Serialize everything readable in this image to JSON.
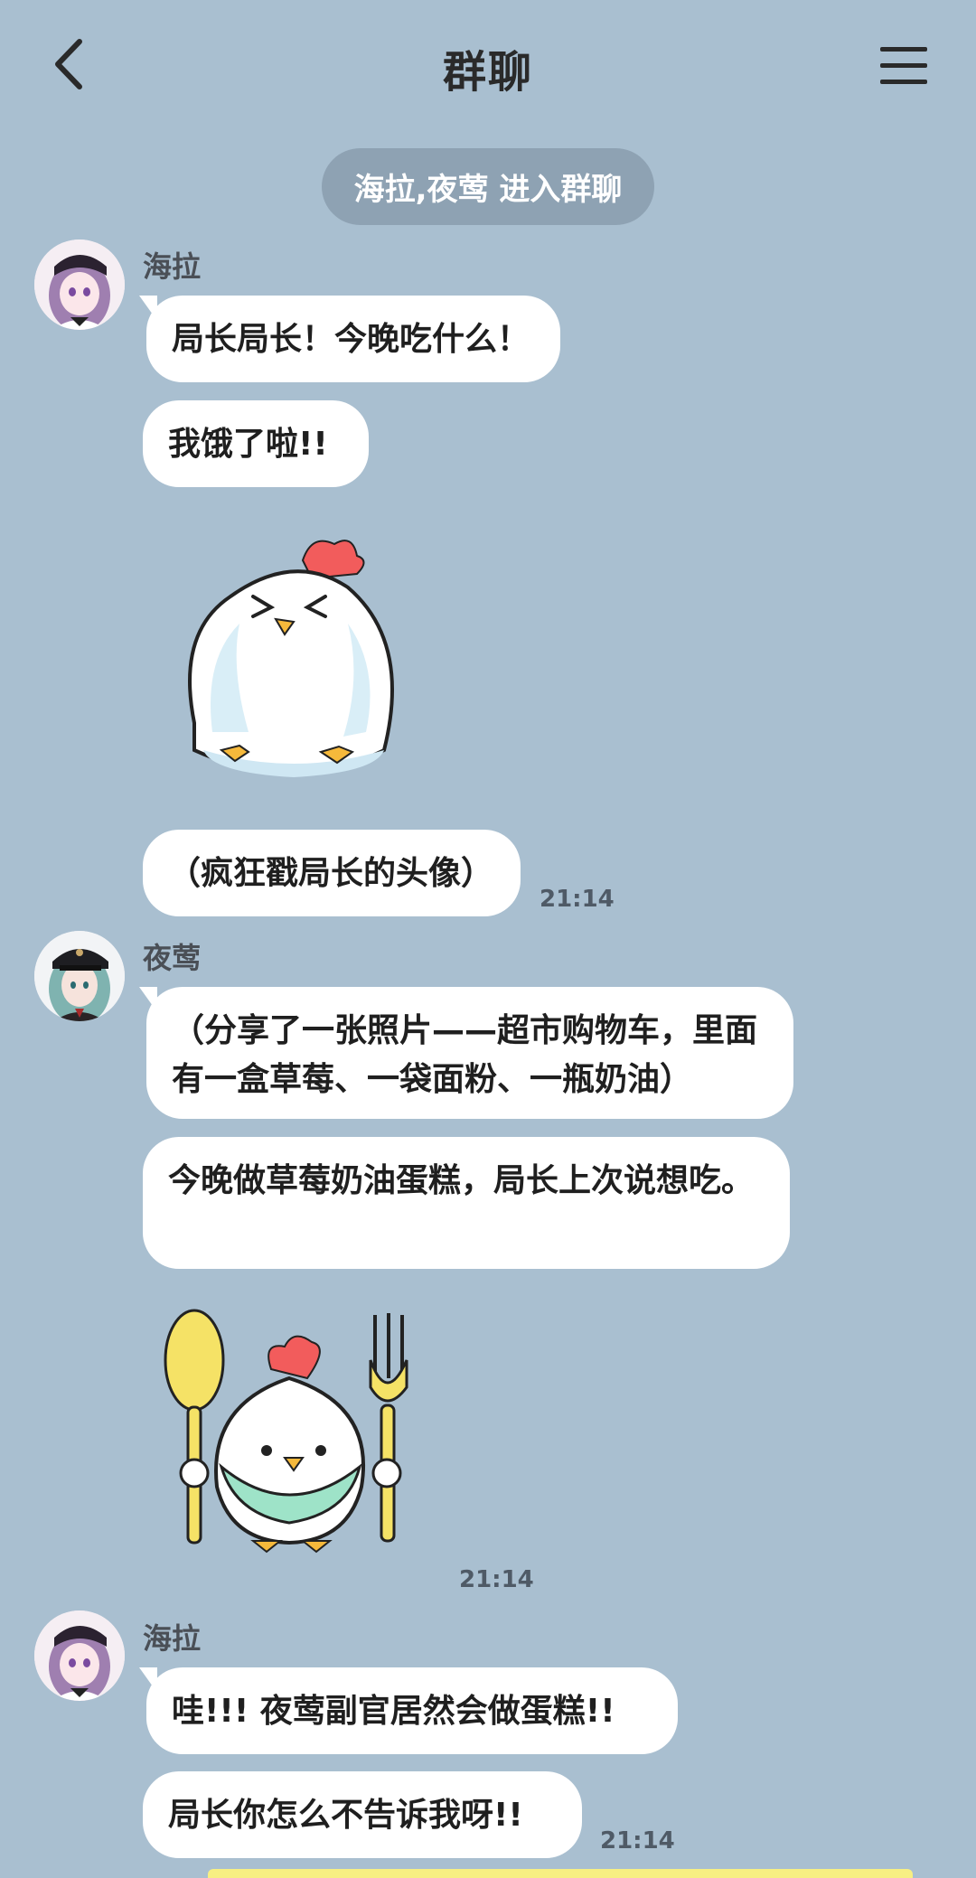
{
  "header": {
    "title": "群聊",
    "back_icon": "chevron-left-icon",
    "menu_icon": "hamburger-menu-icon"
  },
  "system_notice": "海拉,夜莺 进入群聊",
  "messages": {
    "group1": {
      "sender": "海拉",
      "bubble1": "局长局长！今晚吃什么！",
      "bubble2": "我饿了啦!!",
      "sticker": "chick-squinting-sticker",
      "bubble3": "（疯狂戳局长的头像）",
      "time": "21:14"
    },
    "group2": {
      "sender": "夜莺",
      "bubble1": "（分享了一张照片——超市购物车，里面有一盒草莓、一袋面粉、一瓶奶油）",
      "bubble2": "今晚做草莓奶油蛋糕，局长上次说想吃。",
      "sticker": "chick-with-spoon-and-fork-sticker",
      "time": "21:14"
    },
    "group3": {
      "sender": "海拉",
      "bubble1": "哇!!! 夜莺副官居然会做蛋糕!!",
      "bubble2": "局长你怎么不告诉我呀!!",
      "time": "21:14"
    }
  },
  "colors": {
    "background": "#a9bfd0",
    "bubble": "#ffffff",
    "system_pill": "#8ea2b3"
  }
}
